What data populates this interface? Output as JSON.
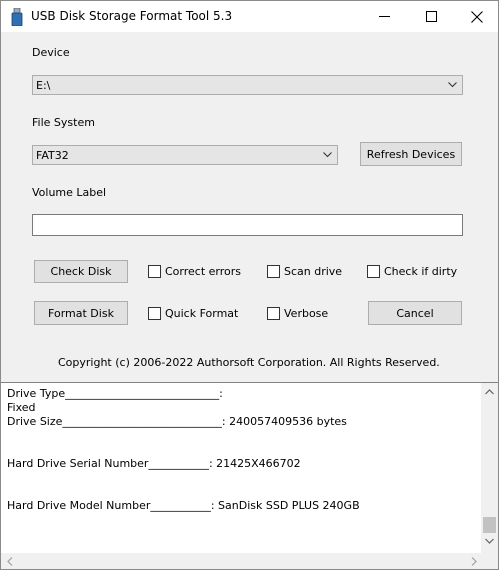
{
  "window": {
    "title": "USB Disk Storage Format Tool 5.3"
  },
  "device": {
    "label": "Device",
    "value": "E:\\"
  },
  "file_system": {
    "label": "File System",
    "value": "FAT32",
    "refresh_label": "Refresh Devices"
  },
  "volume": {
    "label": "Volume Label",
    "value": ""
  },
  "actions": {
    "check_disk": "Check Disk",
    "format_disk": "Format Disk",
    "cancel": "Cancel"
  },
  "options": {
    "correct_errors": "Correct errors",
    "scan_drive": "Scan drive",
    "check_if_dirty": "Check if dirty",
    "quick_format": "Quick Format",
    "verbose": "Verbose"
  },
  "copyright": "Copyright (c) 2006-2022 Authorsoft Corporation. All Rights Reserved.",
  "log": {
    "lines": [
      "Drive Type____________________________:",
      "Fixed",
      "Drive Size_____________________________: 240057409536 bytes",
      "",
      "",
      "Hard Drive Serial Number___________: 21425X466702",
      "",
      "",
      "Hard Drive Model Number___________: SanDisk SSD PLUS 240GB"
    ]
  }
}
